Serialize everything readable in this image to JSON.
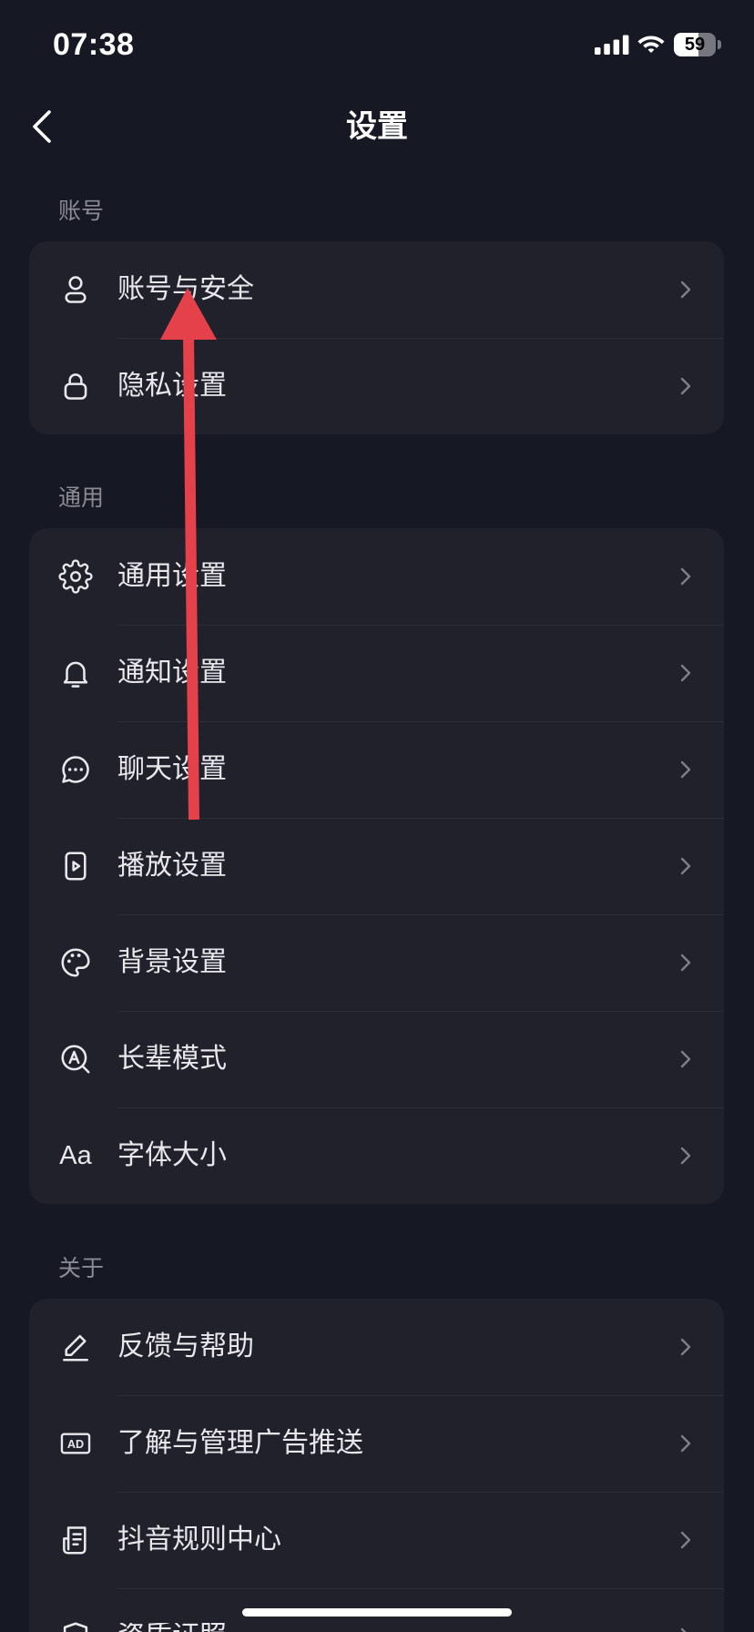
{
  "status_bar": {
    "time": "07:38",
    "battery_percent": "59",
    "icons": [
      "signal-icon",
      "wifi-icon",
      "battery-icon"
    ]
  },
  "header": {
    "title": "设置",
    "back_icon": "chevron-left-icon"
  },
  "sections": [
    {
      "label": "账号",
      "items": [
        {
          "label": "账号与安全",
          "icon": "user-icon"
        },
        {
          "label": "隐私设置",
          "icon": "lock-icon"
        }
      ]
    },
    {
      "label": "通用",
      "items": [
        {
          "label": "通用设置",
          "icon": "gear-icon"
        },
        {
          "label": "通知设置",
          "icon": "bell-icon"
        },
        {
          "label": "聊天设置",
          "icon": "chat-bubble-icon"
        },
        {
          "label": "播放设置",
          "icon": "play-icon"
        },
        {
          "label": "背景设置",
          "icon": "palette-icon"
        },
        {
          "label": "长辈模式",
          "icon": "elder-mode-icon"
        },
        {
          "label": "字体大小",
          "icon": "font-size-icon",
          "icon_text": "Aa"
        }
      ]
    },
    {
      "label": "关于",
      "items": [
        {
          "label": "反馈与帮助",
          "icon": "pencil-icon"
        },
        {
          "label": "了解与管理广告推送",
          "icon": "ad-icon",
          "icon_text": "AD"
        },
        {
          "label": "抖音规则中心",
          "icon": "rules-document-icon"
        },
        {
          "label": "资质证照",
          "icon": "shield-icon"
        }
      ]
    }
  ],
  "row_chevron_icon": "chevron-right-icon",
  "colors": {
    "background": "#161823",
    "card": "#20212B",
    "text_primary": "#E8E8EC",
    "text_secondary": "#8A8B93",
    "divider": "#2D2E39",
    "chevron": "#7E7F89",
    "annotation_arrow": "#E5414B",
    "home_indicator": "#FFFFFF"
  }
}
